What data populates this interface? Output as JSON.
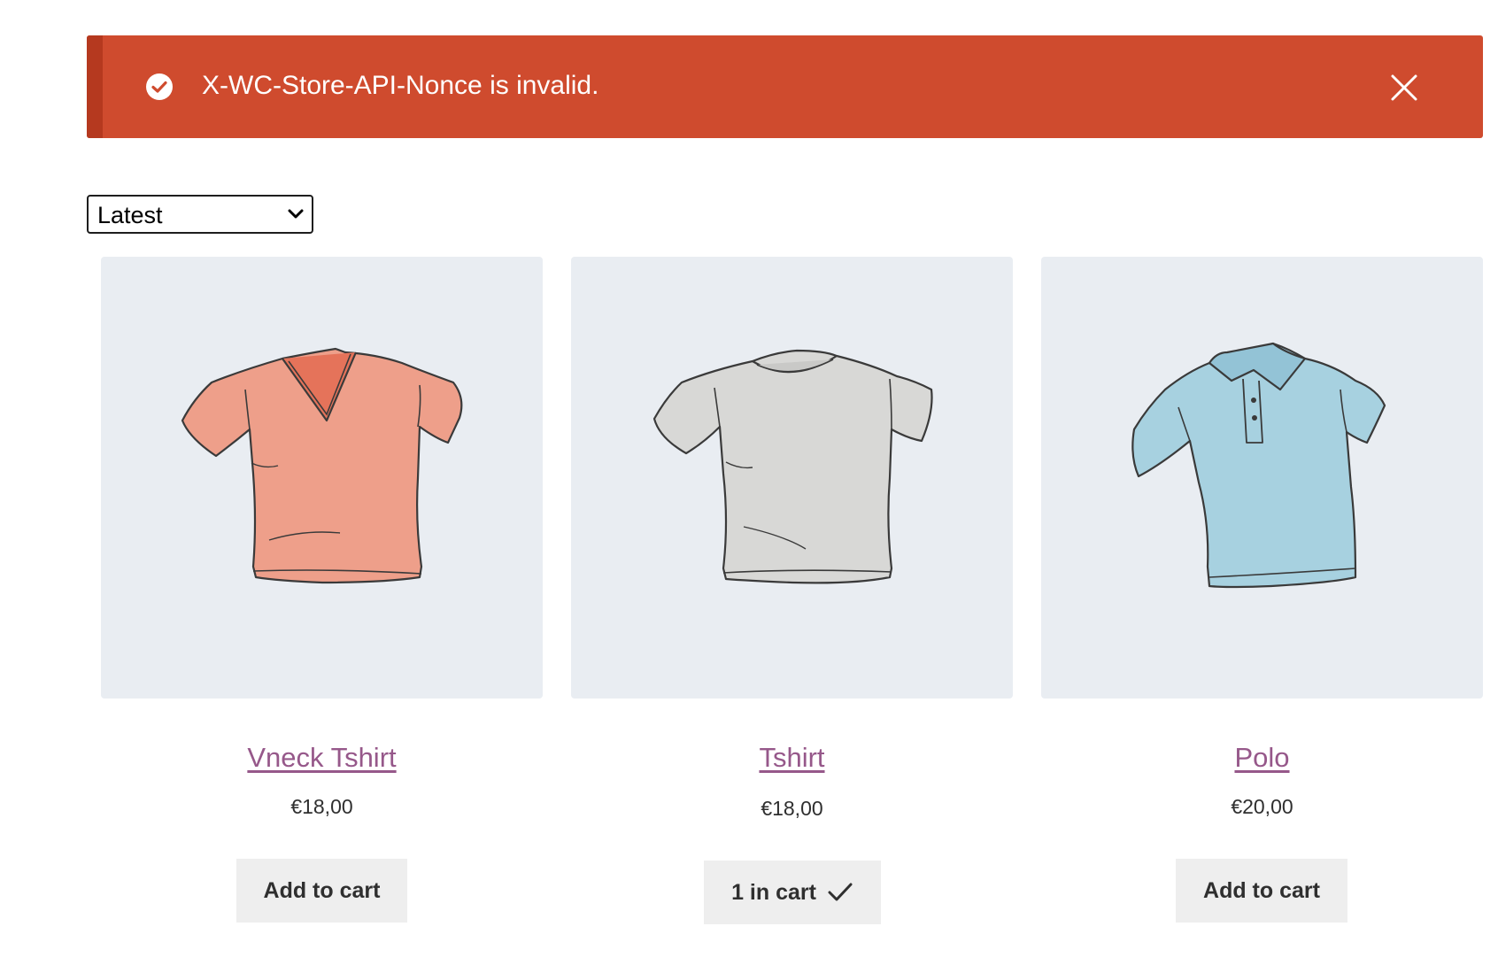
{
  "notice": {
    "message": "X-WC-Store-API-Nonce is invalid.",
    "status_icon": "check-circle-icon",
    "close_icon": "close-icon",
    "background_color": "#cf4b2e"
  },
  "sort": {
    "selected": "Latest"
  },
  "products": [
    {
      "title": "Vneck Tshirt",
      "price": "€18,00",
      "button_label": "Add to cart",
      "image": "vneck-tshirt-illustration",
      "image_color": "#ee9f8a"
    },
    {
      "title": "Tshirt",
      "price": "€18,00",
      "button_label": "1 in cart",
      "button_icon": "checkmark-icon",
      "image": "tshirt-illustration",
      "image_color": "#d8d8d6"
    },
    {
      "title": "Polo",
      "price": "€20,00",
      "button_label": "Add to cart",
      "image": "polo-illustration",
      "image_color": "#a7d1e0"
    }
  ],
  "colors": {
    "link": "#96588a",
    "button_bg": "#eeeeee",
    "image_bg": "#e9edf2"
  }
}
